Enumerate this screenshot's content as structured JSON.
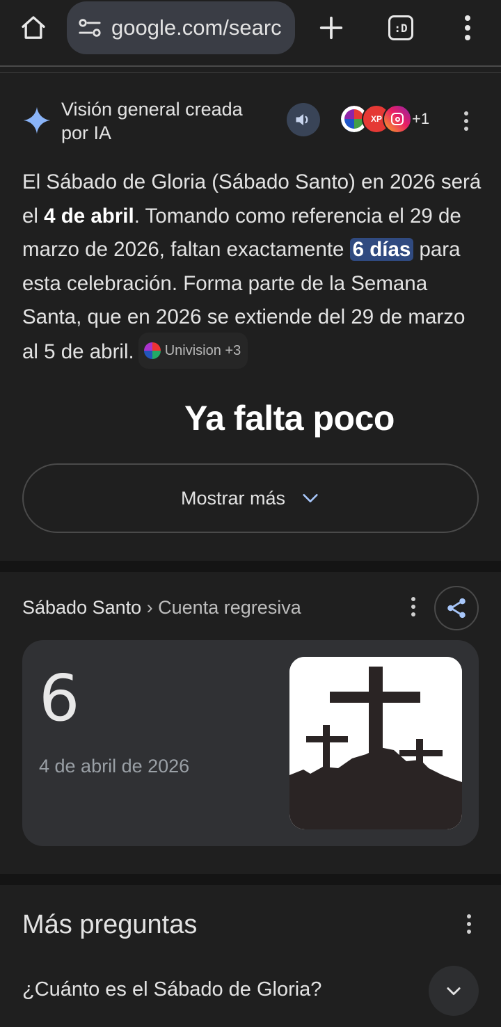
{
  "browser": {
    "url": "google.com/searc",
    "tabs_label": ":D"
  },
  "ai_overview": {
    "title": "Visión general creada por IA",
    "sources_extra": "+1",
    "body": {
      "p1": "El Sábado de Gloria (Sábado Santo) en 2026 será el ",
      "b1": "4 de abril",
      "p2": ". Tomando como referencia el 29 de marzo de 2026, faltan exactamente ",
      "hl": "6 días",
      "p3": " para esta celebración. Forma parte de la Semana Santa, que en 2026 se extiende del 29 de marzo al 5 de abril."
    },
    "citation": "Univision +3",
    "overlay_caption": "Ya falta poco",
    "show_more": "Mostrar más"
  },
  "countdown": {
    "crumb_main": "Sábado Santo",
    "crumb_sep": " › ",
    "crumb_sub": "Cuenta regresiva",
    "number": "6",
    "date": "4 de abril de 2026"
  },
  "more_questions": {
    "title": "Más preguntas",
    "question": "¿Cuánto es el Sábado de Gloria?"
  },
  "colors": {
    "background": "#1f1f1f",
    "highlight": "#304a80",
    "card": "#303134",
    "ai_star": "#8ab4f8"
  }
}
